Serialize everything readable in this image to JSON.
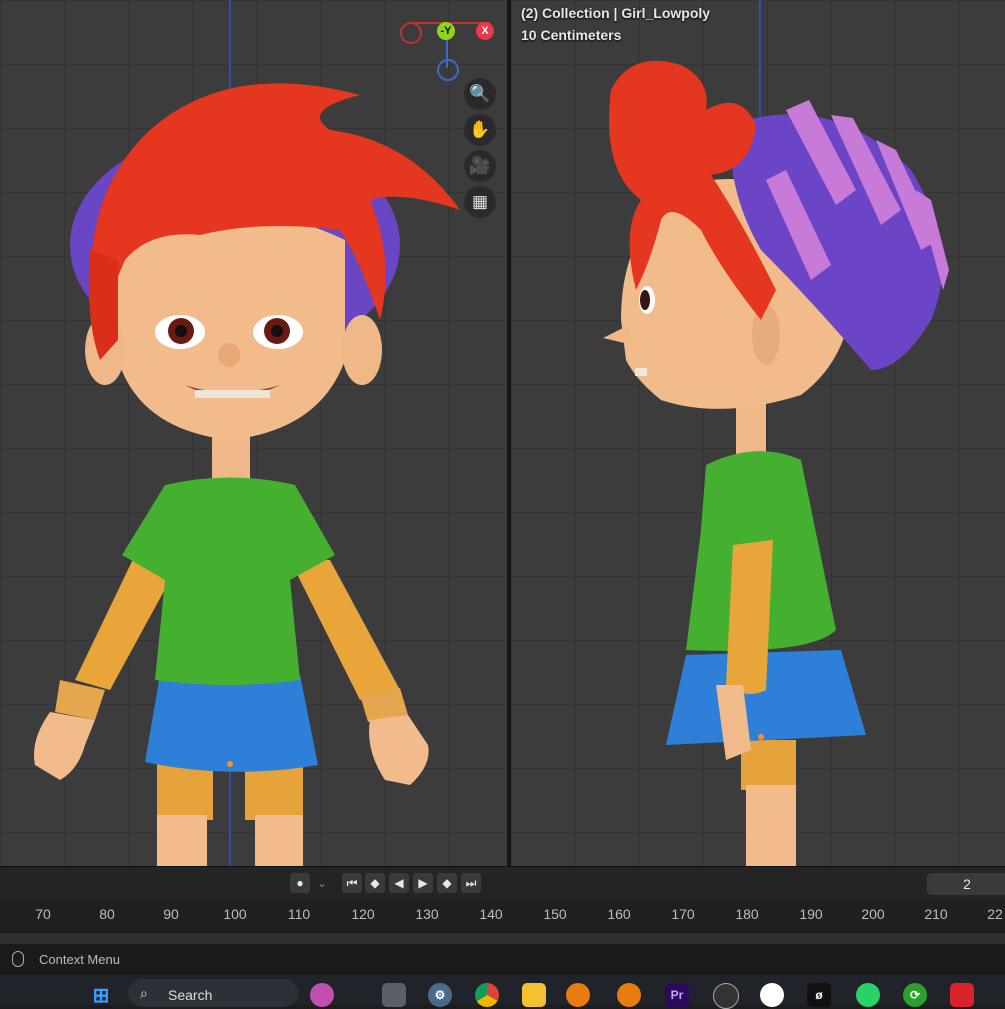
{
  "viewport": {
    "collection_label": "(2) Collection | Girl_Lowpoly",
    "scale_label": "10 Centimeters",
    "gizmo": {
      "y_neg": "-Y",
      "x": "X"
    },
    "tools": [
      "zoom-icon",
      "hand-pan-icon",
      "camera-icon",
      "grid-icon"
    ]
  },
  "playback": {
    "current_frame": "2",
    "buttons": [
      "record",
      "jump-start",
      "prev-keyframe",
      "play-reverse",
      "play",
      "next-keyframe",
      "jump-end"
    ]
  },
  "timeline": {
    "ticks": [
      "70",
      "80",
      "90",
      "100",
      "110",
      "120",
      "130",
      "140",
      "150",
      "160",
      "170",
      "180",
      "190",
      "200",
      "210",
      "22"
    ]
  },
  "status_bar": {
    "context_menu": "Context Menu"
  },
  "taskbar": {
    "search_label": "Search",
    "apps": [
      "windows-start",
      "task-view",
      "settings",
      "chrome",
      "file-explorer",
      "blender",
      "blender",
      "premiere-pro",
      "obs",
      "app-circle",
      "app-slash",
      "whatsapp",
      "sync",
      "acrobat"
    ]
  },
  "colors": {
    "hair": "#e5361f",
    "shirt": "#45b030",
    "sleeves": "#e7a53a",
    "skirt": "#2e7fd8",
    "skin": "#f2bb8b",
    "hat_a": "#6b45c6",
    "hat_b": "#c77ad8",
    "viewport_bg": "#3c3c3c"
  }
}
